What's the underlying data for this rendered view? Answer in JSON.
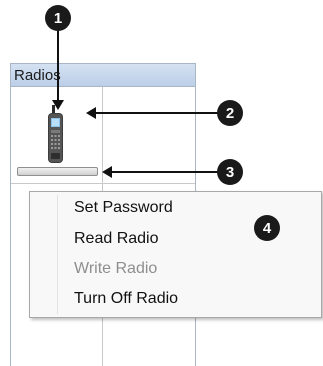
{
  "panel": {
    "title": "Radios"
  },
  "context_menu": {
    "items": [
      {
        "label": "Set Password",
        "enabled": true
      },
      {
        "label": "Read Radio",
        "enabled": true
      },
      {
        "label": "Write Radio",
        "enabled": false
      },
      {
        "label": "Turn Off Radio",
        "enabled": true
      }
    ]
  },
  "callouts": [
    "1",
    "2",
    "3",
    "4"
  ],
  "icons": {
    "radio": "handheld-radio-icon"
  },
  "colors": {
    "header": "#c7d7ee",
    "callout": "#1a1a1a",
    "menu_bg": "#f8f8f8",
    "disabled_text": "#8e8e8e"
  }
}
